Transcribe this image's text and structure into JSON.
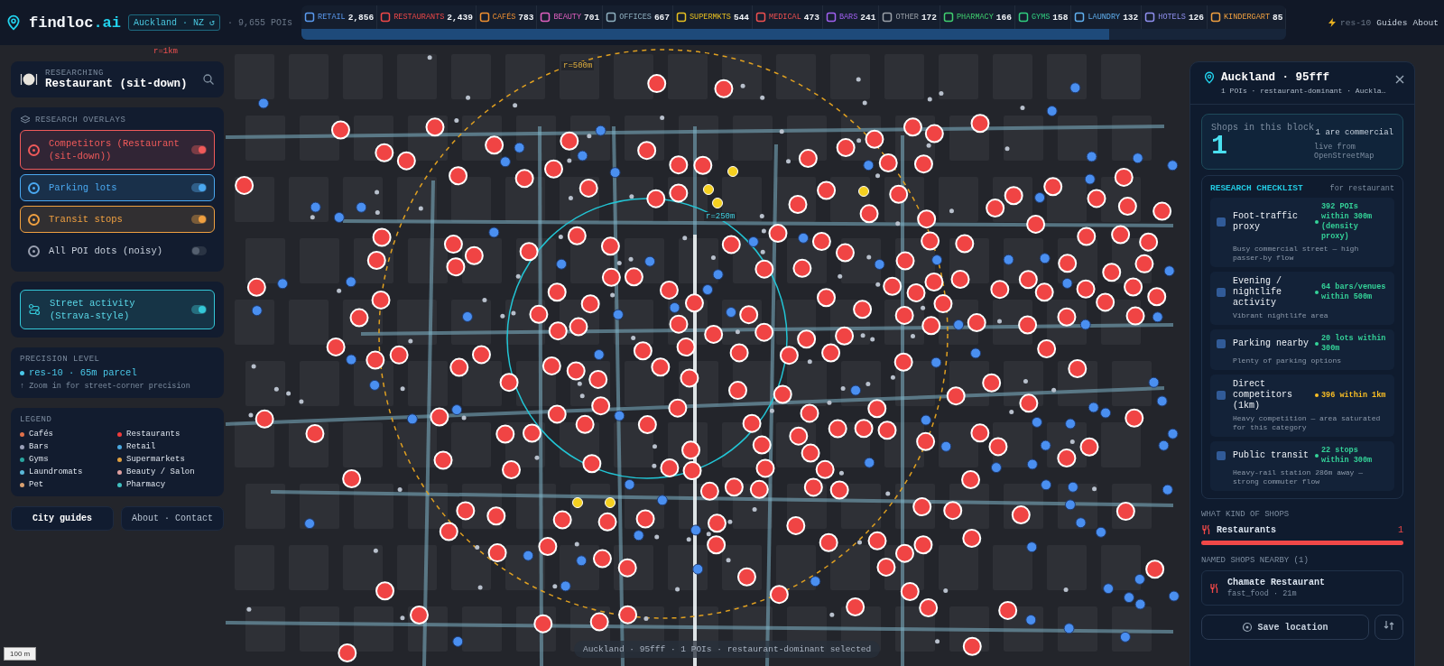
{
  "header": {
    "brand": "findloc",
    "brand_tld": ".ai",
    "city": "Auckland · NZ ↺",
    "poi_total": "· 9,655 POIs",
    "load_progress": {
      "level": 0.82
    },
    "precision": "res-10",
    "links": [
      "Guides",
      "About"
    ]
  },
  "categories": [
    {
      "label": "RETAIL",
      "count": "2,856",
      "color": "#5b9bf0"
    },
    {
      "label": "RESTAURANTS",
      "count": "2,439",
      "color": "#f04848"
    },
    {
      "label": "CAFÉS",
      "count": "783",
      "color": "#f09030"
    },
    {
      "label": "BEAUTY",
      "count": "701",
      "color": "#e060c0"
    },
    {
      "label": "OFFICES",
      "count": "667",
      "color": "#8fb0c0"
    },
    {
      "label": "SUPERMKTS",
      "count": "544",
      "color": "#e8c020"
    },
    {
      "label": "MEDICAL",
      "count": "473",
      "color": "#f05050"
    },
    {
      "label": "BARS",
      "count": "241",
      "color": "#a060f0"
    },
    {
      "label": "OTHER",
      "count": "172",
      "color": "#9aa0a8"
    },
    {
      "label": "PHARMACY",
      "count": "166",
      "color": "#40d070"
    },
    {
      "label": "GYMS",
      "count": "158",
      "color": "#30d080"
    },
    {
      "label": "LAUNDRY",
      "count": "132",
      "color": "#60b0f0"
    },
    {
      "label": "HOTELS",
      "count": "126",
      "color": "#9090f0"
    },
    {
      "label": "KINDERGART",
      "count": "85",
      "color": "#f0a040"
    }
  ],
  "research": {
    "label": "RESEARCHING",
    "title": "Restaurant (sit-down)"
  },
  "overlays": {
    "title": "RESEARCH OVERLAYS",
    "items": [
      {
        "label": "Competitors (Restaurant (sit-down))",
        "on": true,
        "color": "#f05a5a"
      },
      {
        "label": "Parking lots",
        "on": true,
        "color": "#4aa8f0"
      },
      {
        "label": "Transit stops",
        "on": true,
        "color": "#f0a040"
      },
      {
        "label": "All POI dots (noisy)",
        "on": false,
        "color": "#9aa0b0"
      }
    ]
  },
  "street_activity": {
    "label": "Street activity (Strava-style)",
    "on": true
  },
  "precision": {
    "title": "PRECISION LEVEL",
    "value": "res-10 · 65m parcel",
    "hint": "↑ Zoom in for street-corner precision"
  },
  "legend": {
    "title": "LEGEND",
    "items": [
      {
        "label": "Cafés",
        "color": "#e0704a"
      },
      {
        "label": "Restaurants",
        "color": "#ef3b3b"
      },
      {
        "label": "Bars",
        "color": "#9aa0b8"
      },
      {
        "label": "Retail",
        "color": "#4aa8e0"
      },
      {
        "label": "Gyms",
        "color": "#2aa6a0"
      },
      {
        "label": "Supermarkets",
        "color": "#e0a040"
      },
      {
        "label": "Laundromats",
        "color": "#5ab8d8"
      },
      {
        "label": "Beauty / Salon",
        "color": "#e0a0a0"
      },
      {
        "label": "Pet",
        "color": "#d8a070"
      },
      {
        "label": "Pharmacy",
        "color": "#40c0c0"
      }
    ]
  },
  "footer_buttons": [
    "City guides",
    "About · Contact"
  ],
  "map": {
    "radius_labels": [
      "r=1km",
      "r=500m",
      "r=250m"
    ],
    "scale": "100 m",
    "toast": "Auckland · 95fff · 1 POIs · restaurant-dominant selected"
  },
  "detail": {
    "title": "Auckland · 95fff",
    "subtitle": "1 POIs · restaurant-dominant · Auckla…",
    "stat": {
      "label": "Shops in this block",
      "value": "1",
      "note": "1 are commercial",
      "source": "live from OpenStreetMap"
    },
    "checklist": {
      "title": "RESEARCH CHECKLIST",
      "scope": "for restaurant",
      "items": [
        {
          "title": "Foot-traffic proxy",
          "value": "392 POIs within 300m (density proxy)",
          "note": "Busy commercial street — high passer-by flow",
          "color": "#34d399"
        },
        {
          "title": "Evening / nightlife activity",
          "value": "64 bars/venues within 500m",
          "note": "Vibrant nightlife area",
          "color": "#34d399"
        },
        {
          "title": "Parking nearby",
          "value": "20 lots within 300m",
          "note": "Plenty of parking options",
          "color": "#34d399"
        },
        {
          "title": "Direct competitors (1km)",
          "value": "396 within 1km",
          "note": "Heavy competition — area saturated for this category",
          "color": "#fbbf24"
        },
        {
          "title": "Public transit",
          "value": "22 stops within 300m",
          "note": "Heavy-rail station 286m away — strong commuter flow",
          "color": "#34d399"
        }
      ]
    },
    "kinds": {
      "title": "WHAT KIND OF SHOPS",
      "items": [
        {
          "label": "Restaurants",
          "count": "1",
          "level": 1.0
        }
      ]
    },
    "named": {
      "title": "NAMED SHOPS NEARBY (1)",
      "items": [
        {
          "name": "Chamate Restaurant",
          "meta": "fast_food · 21m"
        }
      ]
    },
    "save_button": "Save location"
  }
}
